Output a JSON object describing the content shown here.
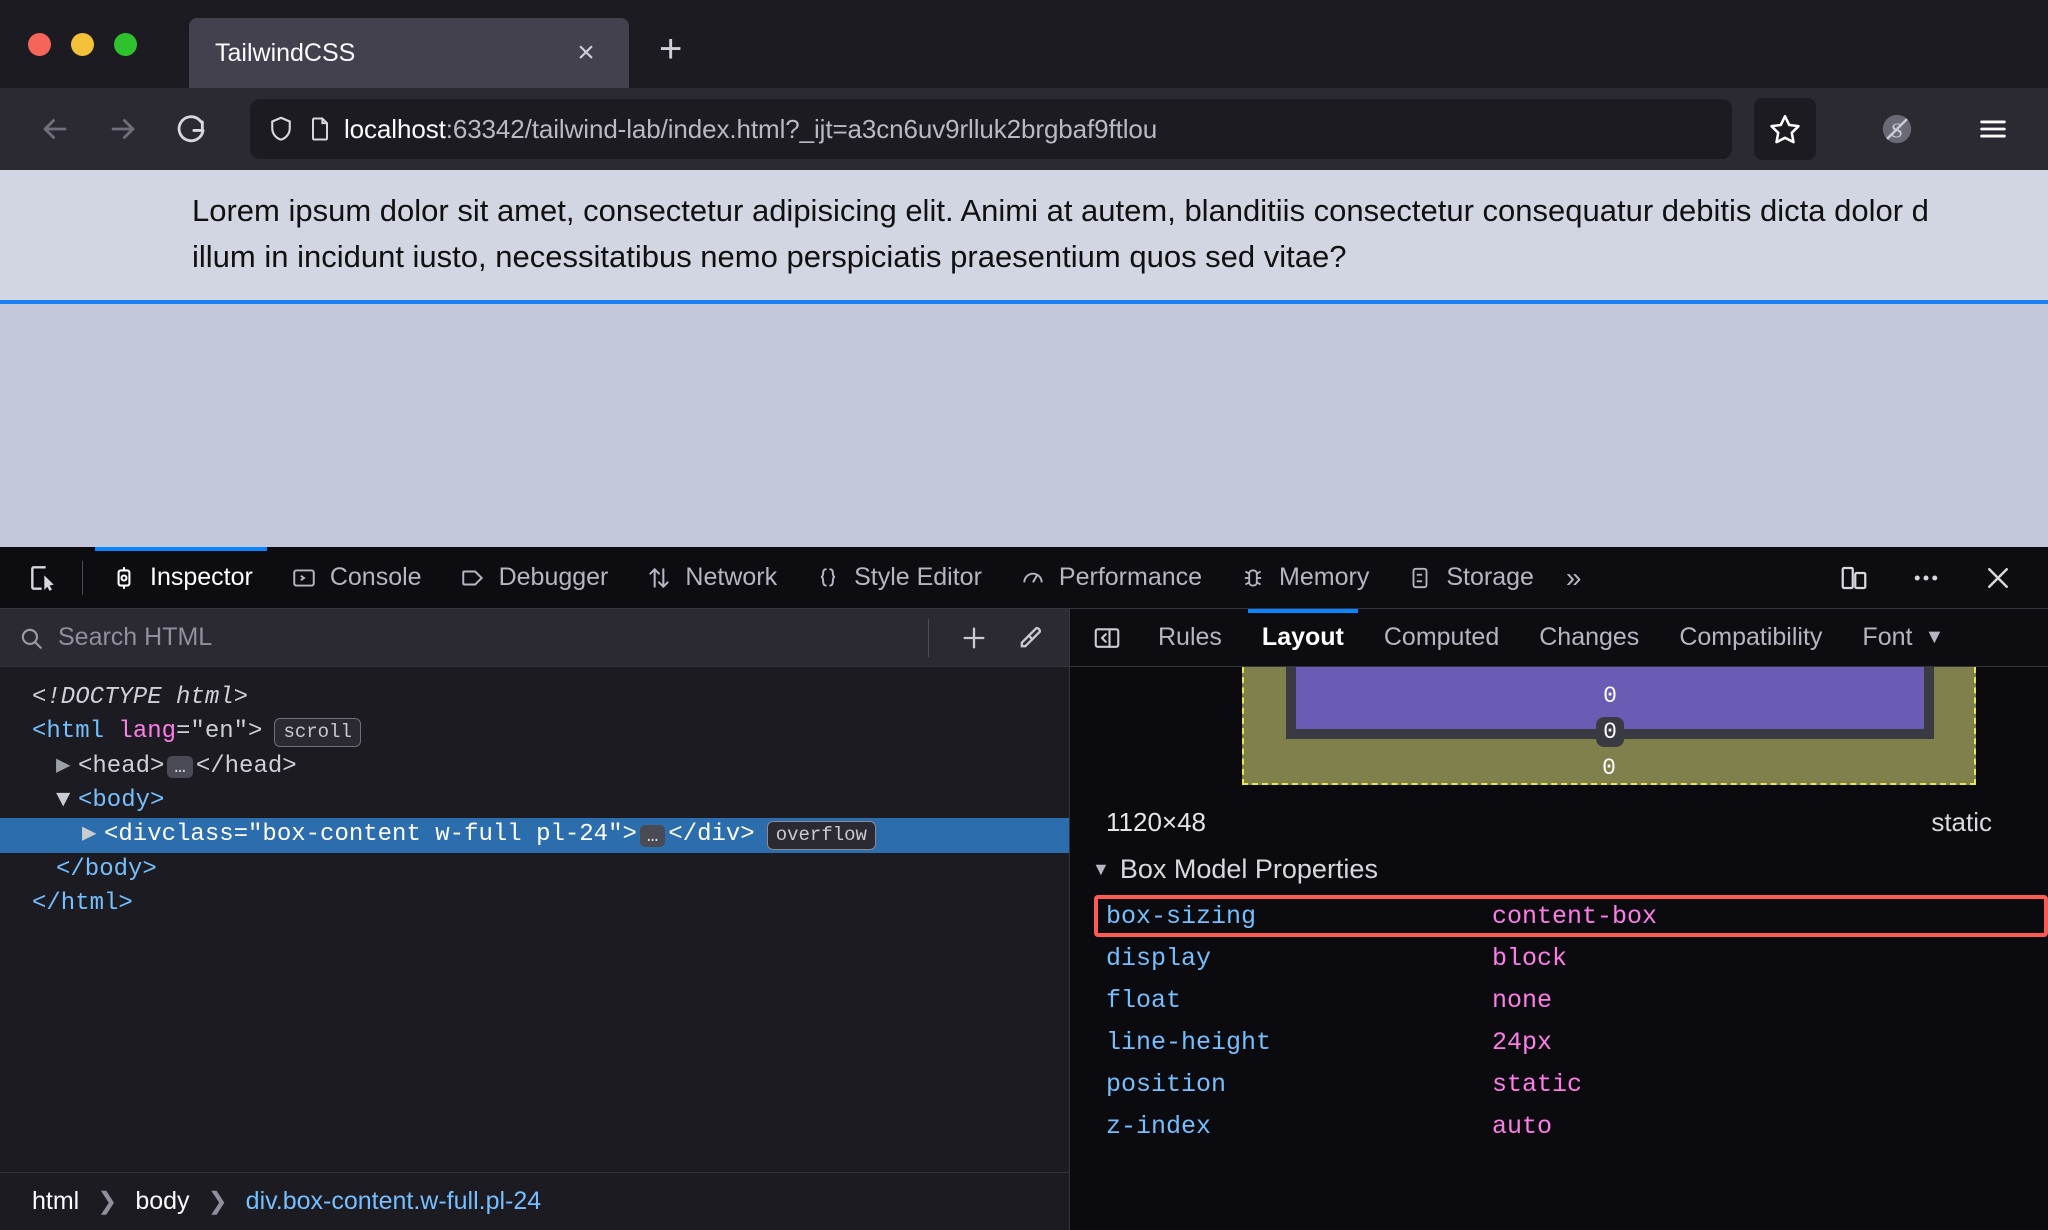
{
  "browser": {
    "tab": {
      "title": "TailwindCSS",
      "close_label": "×"
    },
    "new_tab_label": "+",
    "url": {
      "host": "localhost",
      "rest": ":63342/tailwind-lab/index.html?_ijt=a3cn6uv9rlluk2brgbaf9ftlou"
    },
    "nav": {
      "back": "back-icon",
      "forward": "forward-icon",
      "reload": "reload-icon",
      "shield": "shield-icon",
      "page": "page-icon",
      "bookmark": "star-icon",
      "extension": "extension-icon",
      "menu": "hamburger-menu-icon"
    }
  },
  "page": {
    "line1": "Lorem ipsum dolor sit amet, consectetur adipisicing elit. Animi at autem, blanditiis consectetur consequatur debitis dicta dolor d",
    "line2": "illum in incidunt iusto, necessitatibus nemo perspiciatis praesentium quos sed vitae?"
  },
  "devtools": {
    "tabs": [
      {
        "label": "Inspector",
        "icon": "inspector-icon",
        "active": true
      },
      {
        "label": "Console",
        "icon": "console-icon",
        "active": false
      },
      {
        "label": "Debugger",
        "icon": "debugger-icon",
        "active": false
      },
      {
        "label": "Network",
        "icon": "network-icon",
        "active": false
      },
      {
        "label": "Style Editor",
        "icon": "style-editor-icon",
        "active": false
      },
      {
        "label": "Performance",
        "icon": "performance-icon",
        "active": false
      },
      {
        "label": "Memory",
        "icon": "memory-icon",
        "active": false
      },
      {
        "label": "Storage",
        "icon": "storage-icon",
        "active": false
      }
    ],
    "overflow_label": "»",
    "right_buttons": [
      "responsive-design-mode-icon",
      "devtools-options-icon",
      "close-devtools-icon"
    ],
    "search": {
      "placeholder": "Search HTML",
      "value": ""
    },
    "markup": {
      "lines": [
        {
          "text": "<!DOCTYPE html>"
        },
        {
          "tag": "html",
          "attr": "lang",
          "value": "\"en\"",
          "badge": "scroll"
        },
        {
          "tag": "head",
          "badge": ""
        },
        {
          "tag": "body"
        },
        {
          "tag": "div",
          "attr": "class",
          "value": "\"box-content w-full pl-24\"",
          "badge": "overflow",
          "selected": true
        },
        {
          "text": "</body>"
        },
        {
          "text": "</html>"
        }
      ],
      "doctype": "<!DOCTYPE html>",
      "html_open": "<html",
      "html_lang_attr": "lang",
      "html_lang_val": "=\"en\">",
      "html_badge": "scroll",
      "head_open": "<head>",
      "head_close": "</head>",
      "body_open": "<body>",
      "div_open": "<div ",
      "div_class_attr": "class",
      "div_class_val": "=\"box-content w-full pl-24\">",
      "div_close": "</div>",
      "div_badge": "overflow",
      "body_close": "</body>",
      "html_close": "</html>",
      "ellipsis": "…"
    },
    "breadcrumbs": [
      {
        "label": "html",
        "link": false
      },
      {
        "label": "body",
        "link": false
      },
      {
        "label": "div.box-content.w-full.pl-24",
        "link": true
      }
    ],
    "breadcrumb_separator": "❯",
    "sidebar": {
      "tabs": [
        {
          "label": "Rules",
          "active": false
        },
        {
          "label": "Layout",
          "active": true
        },
        {
          "label": "Computed",
          "active": false
        },
        {
          "label": "Changes",
          "active": false
        },
        {
          "label": "Compatibility",
          "active": false
        },
        {
          "label": "Font",
          "active": false
        }
      ],
      "more_indicator": "▼",
      "box_model": {
        "padding_bottom": "0",
        "border_bottom": "0",
        "margin_bottom": "0",
        "colors": {
          "margin": "#80804d",
          "border": "#3a3a42",
          "padding": "#6a5bb5",
          "margin_outline": "#e8e84a"
        }
      },
      "dimensions": "1120×48",
      "position_value": "static",
      "box_model_properties_label": "Box Model Properties",
      "properties": [
        {
          "name": "box-sizing",
          "value": "content-box",
          "highlighted": true
        },
        {
          "name": "display",
          "value": "block",
          "highlighted": false
        },
        {
          "name": "float",
          "value": "none",
          "highlighted": false
        },
        {
          "name": "line-height",
          "value": "24px",
          "highlighted": false
        },
        {
          "name": "position",
          "value": "static",
          "highlighted": false
        },
        {
          "name": "z-index",
          "value": "auto",
          "highlighted": false
        }
      ],
      "highlight_color": "#ff5a52"
    }
  }
}
